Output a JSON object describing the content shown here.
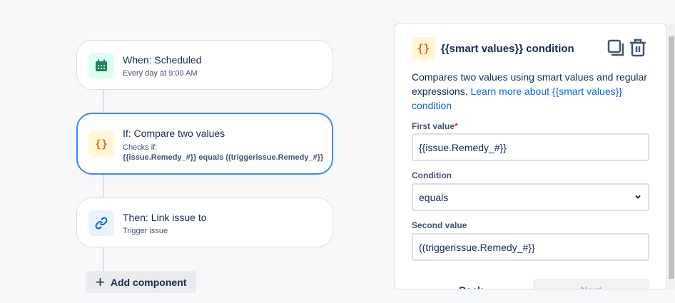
{
  "flow": {
    "trigger": {
      "title": "When: Scheduled",
      "subtitle": "Every day at 9:00 AM"
    },
    "condition": {
      "title": "If: Compare two values",
      "subtitle": "Checks if:",
      "detail": "{{issue.Remedy_#}} equals ((triggerissue.Remedy_#}}"
    },
    "action": {
      "title": "Then: Link issue to",
      "subtitle": "Trigger issue"
    },
    "add_label": "Add component"
  },
  "panel": {
    "icon_text": "{}",
    "title": "{{smart values}} condition",
    "description": "Compares two values using smart values and regular expressions.",
    "link": "Learn more about {{smart values}} condition",
    "first_label": "First value",
    "required": "*",
    "first_value": "{{issue.Remedy_#}}",
    "condition_label": "Condition",
    "condition_value": "equals",
    "second_label": "Second value",
    "second_value": "((triggerissue.Remedy_#}}",
    "back": "Back",
    "next": "Next"
  },
  "colors": {
    "accent": "#388bff",
    "link": "#0c66e4",
    "orange": "#e56910"
  }
}
